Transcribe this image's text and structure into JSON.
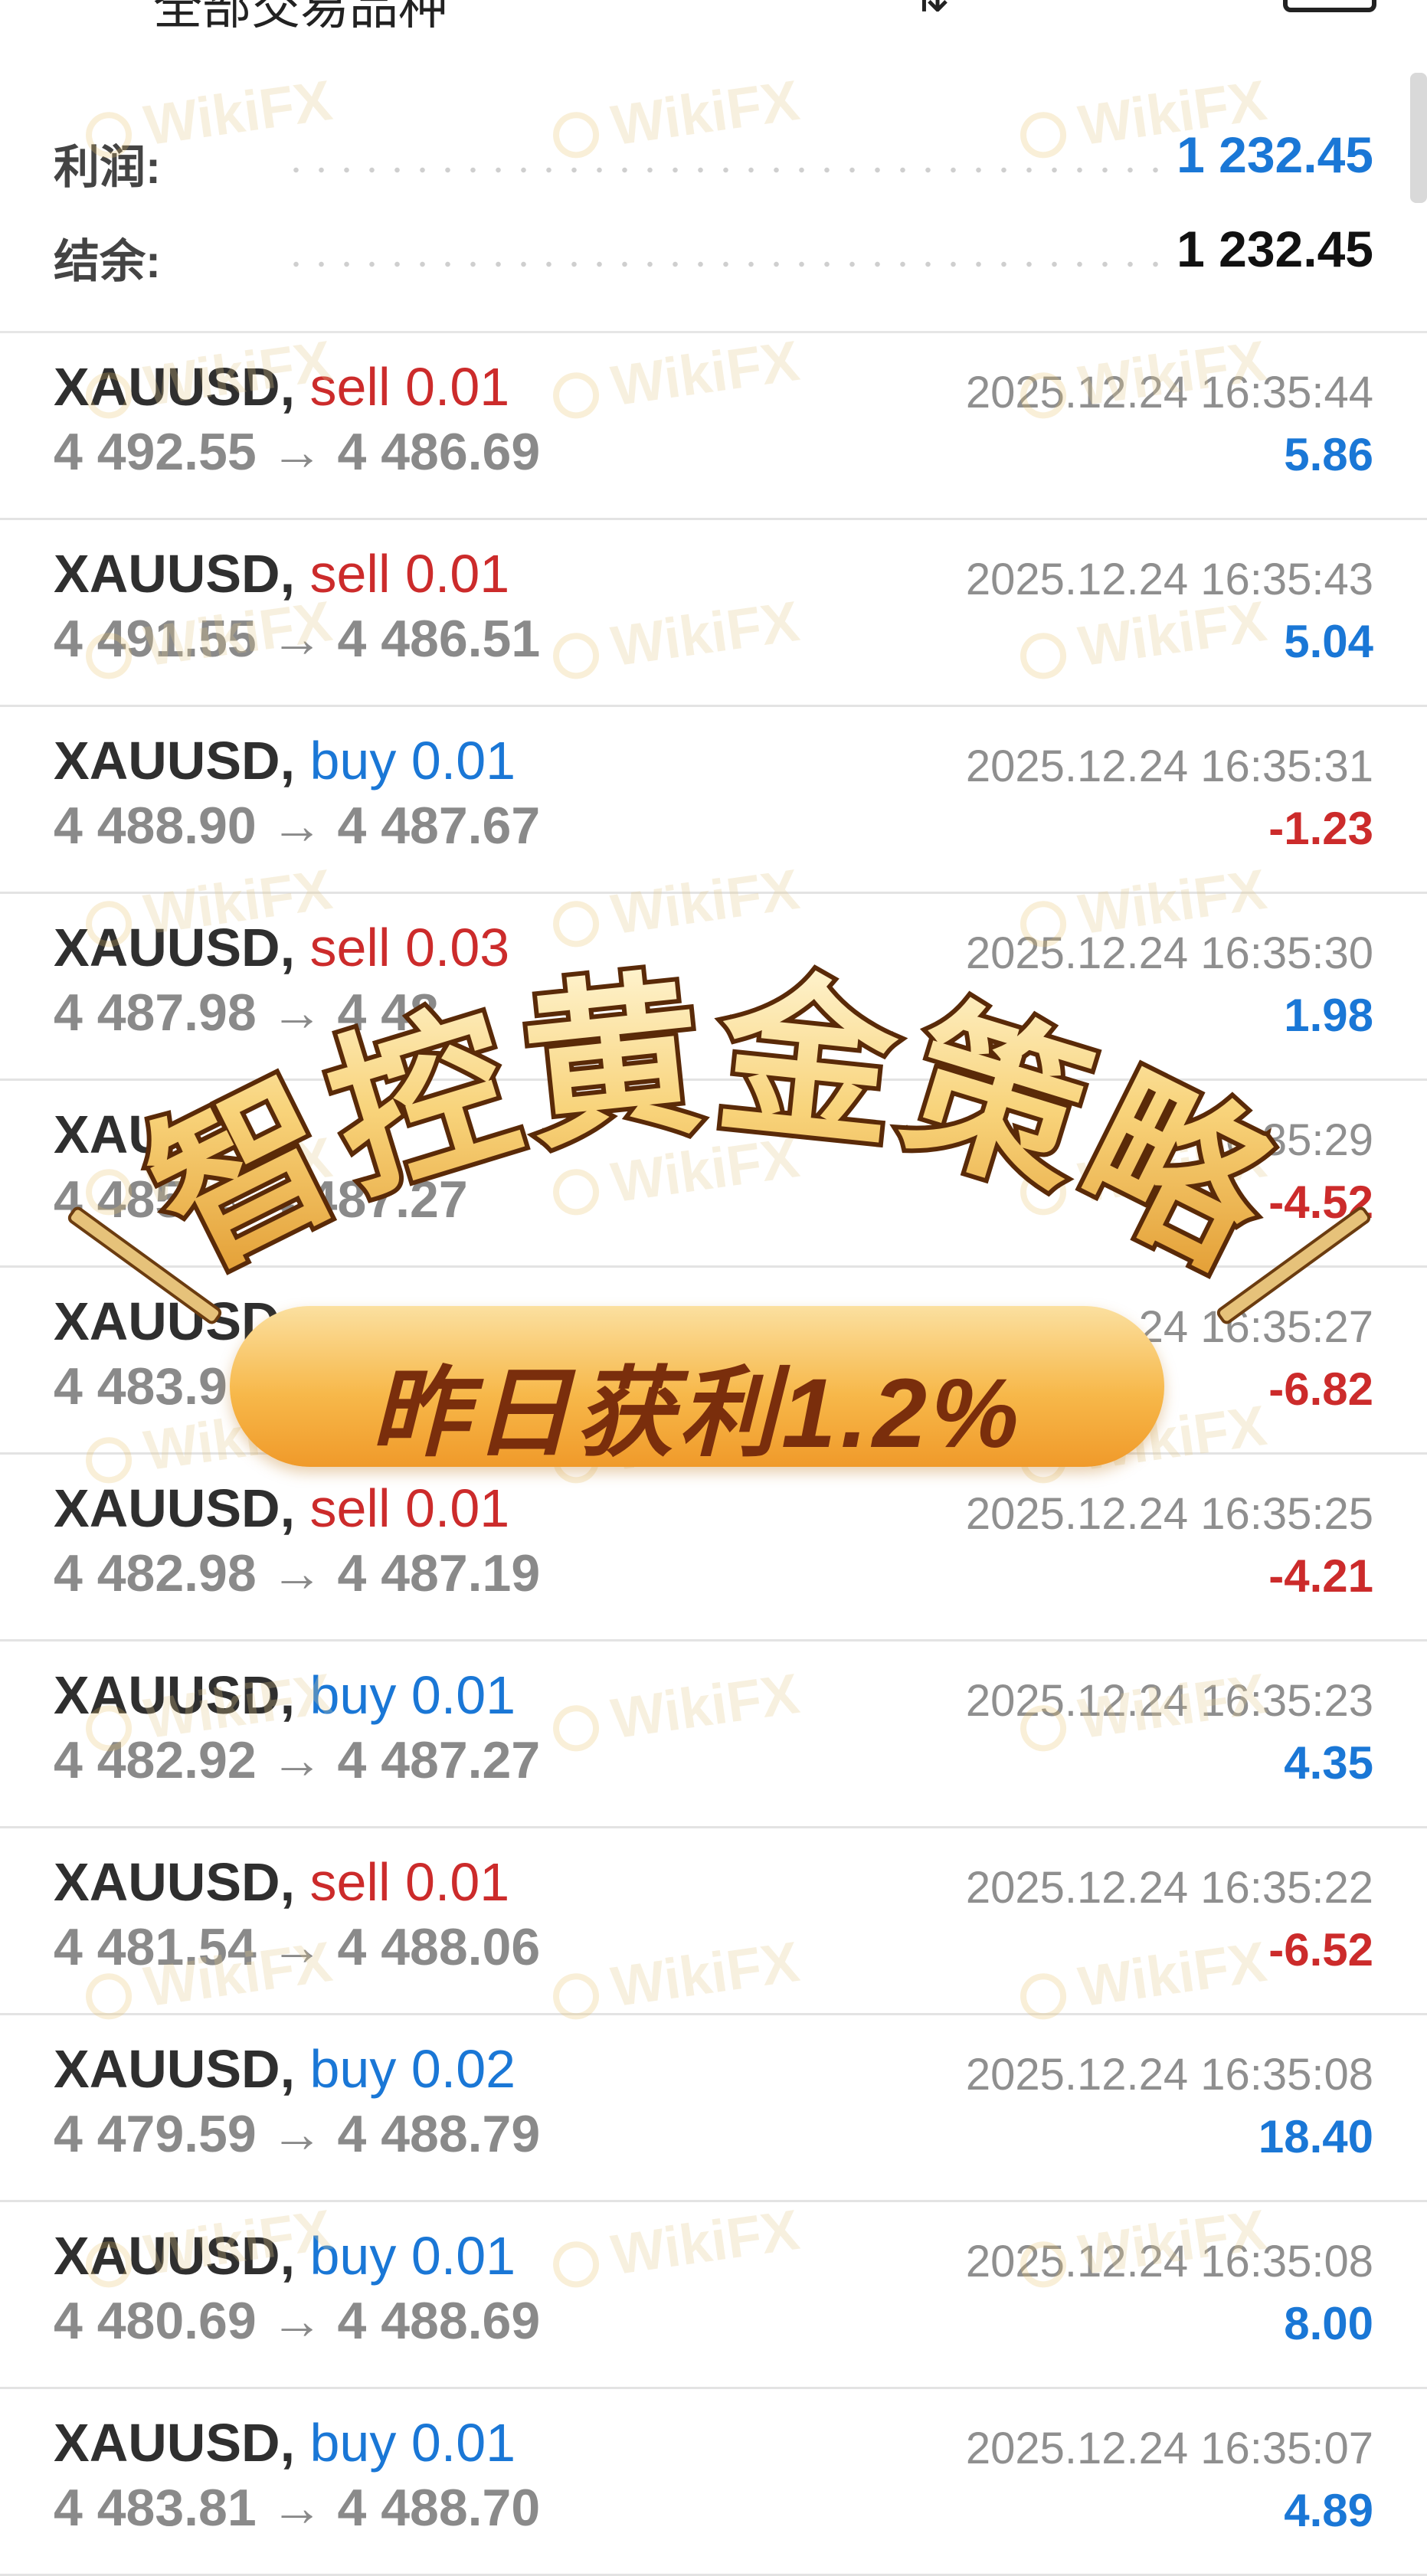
{
  "header": {
    "title": "全部交易品种"
  },
  "summary": {
    "profit_label": "利润:",
    "profit_value": "1 232.45",
    "balance_label": "结余:",
    "balance_value": "1 232.45"
  },
  "trades": [
    {
      "symbol": "XAUUSD",
      "side": "sell",
      "volume": "0.01",
      "open": "4 492.55",
      "close": "4 486.69",
      "time": "2025.12.24 16:35:44",
      "profit": "5.86"
    },
    {
      "symbol": "XAUUSD",
      "side": "sell",
      "volume": "0.01",
      "open": "4 491.55",
      "close": "4 486.51",
      "time": "2025.12.24 16:35:43",
      "profit": "5.04"
    },
    {
      "symbol": "XAUUSD",
      "side": "buy",
      "volume": "0.01",
      "open": "4 488.90",
      "close": "4 487.67",
      "time": "2025.12.24 16:35:31",
      "profit": "-1.23"
    },
    {
      "symbol": "XAUUSD",
      "side": "sell",
      "volume": "0.03",
      "open": "4 487.98",
      "close": "4 48",
      "time": "2025.12.24 16:35:30",
      "profit": "1.98"
    },
    {
      "symbol": "XAU",
      "side": "",
      "volume": "",
      "open": "4 485",
      "close": "4 487.27",
      "time": "6:35:29",
      "profit": "-4.52"
    },
    {
      "symbol": "XAUUSD",
      "side": "",
      "volume": "",
      "open": "4 483.9",
      "close": "",
      "time": "24 16:35:27",
      "profit": "-6.82"
    },
    {
      "symbol": "XAUUSD",
      "side": "sell",
      "volume": "0.01",
      "open": "4 482.98",
      "close": "4 487.19",
      "time": "2025.12.24 16:35:25",
      "profit": "-4.21"
    },
    {
      "symbol": "XAUUSD",
      "side": "buy",
      "volume": "0.01",
      "open": "4 482.92",
      "close": "4 487.27",
      "time": "2025.12.24 16:35:23",
      "profit": "4.35"
    },
    {
      "symbol": "XAUUSD",
      "side": "sell",
      "volume": "0.01",
      "open": "4 481.54",
      "close": "4 488.06",
      "time": "2025.12.24 16:35:22",
      "profit": "-6.52"
    },
    {
      "symbol": "XAUUSD",
      "side": "buy",
      "volume": "0.02",
      "open": "4 479.59",
      "close": "4 488.79",
      "time": "2025.12.24 16:35:08",
      "profit": "18.40"
    },
    {
      "symbol": "XAUUSD",
      "side": "buy",
      "volume": "0.01",
      "open": "4 480.69",
      "close": "4 488.69",
      "time": "2025.12.24 16:35:08",
      "profit": "8.00"
    },
    {
      "symbol": "XAUUSD",
      "side": "buy",
      "volume": "0.01",
      "open": "4 483.81",
      "close": "4 488.70",
      "time": "2025.12.24 16:35:07",
      "profit": "4.89"
    }
  ],
  "promo": {
    "headline": "智控黄金策略",
    "subline": "昨日获利1.2%"
  },
  "watermark": "WikiFX",
  "colors": {
    "sell": "#cc2b2b",
    "buy": "#1a77d6",
    "profit_positive": "#1a77d6",
    "profit_negative": "#cc2b2b",
    "gold": "#f7b84a"
  }
}
